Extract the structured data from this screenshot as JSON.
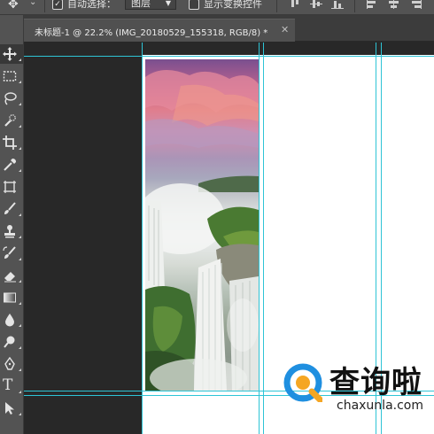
{
  "options_bar": {
    "tool_icon": "move-icon",
    "auto_select_label": "自动选择：",
    "auto_select_checked": true,
    "auto_select_target": "图层",
    "show_transform_label": "显示变换控件",
    "show_transform_checked": false,
    "align_icons": [
      "align-top-icon",
      "align-vertical-center-icon",
      "align-bottom-icon",
      "align-left-icon",
      "align-horizontal-center-icon",
      "align-right-icon"
    ]
  },
  "document_tab": {
    "title": "未标题-1 @ 22.2% (IMG_20180529_155318, RGB/8) *",
    "close_icon": "close-icon"
  },
  "toolbar": {
    "tools": [
      {
        "name": "move-tool",
        "icon": "move-icon",
        "active": true
      },
      {
        "name": "marquee-tool",
        "icon": "rectangular-marquee-icon"
      },
      {
        "name": "lasso-tool",
        "icon": "lasso-icon"
      },
      {
        "name": "quick-selection-tool",
        "icon": "quick-selection-icon"
      },
      {
        "name": "crop-tool",
        "icon": "crop-icon"
      },
      {
        "name": "eyedropper-tool",
        "icon": "eyedropper-icon"
      },
      {
        "name": "frame-tool",
        "icon": "frame-icon"
      },
      {
        "name": "brush-tool",
        "icon": "brush-icon"
      },
      {
        "name": "clone-stamp-tool",
        "icon": "stamp-icon"
      },
      {
        "name": "history-brush-tool",
        "icon": "history-brush-icon"
      },
      {
        "name": "eraser-tool",
        "icon": "eraser-icon"
      },
      {
        "name": "gradient-tool",
        "icon": "gradient-icon"
      },
      {
        "name": "blur-tool",
        "icon": "blur-drop-icon"
      },
      {
        "name": "dodge-tool",
        "icon": "dodge-icon"
      },
      {
        "name": "pen-tool",
        "icon": "pen-icon"
      },
      {
        "name": "type-tool",
        "icon": "type-icon",
        "glyph": "T"
      },
      {
        "name": "path-selection-tool",
        "icon": "path-selection-icon"
      }
    ]
  },
  "canvas": {
    "zoom": "22.2%",
    "layer_name": "IMG_20180529_155318",
    "guide_color": "#2ec4d6"
  },
  "watermark": {
    "text": "查询啦",
    "url": "chaxunla.com",
    "brand_color": "#1f8fe0",
    "accent_color": "#f5a623"
  }
}
